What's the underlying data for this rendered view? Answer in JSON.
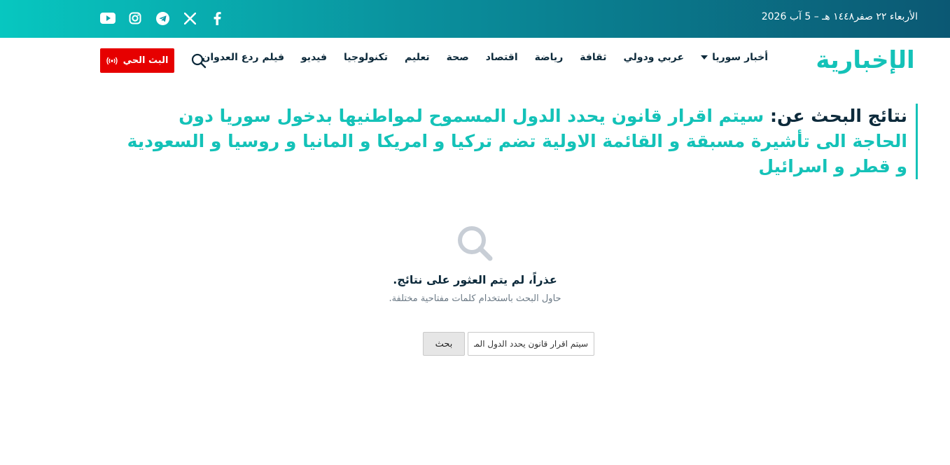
{
  "topbar": {
    "date": "الأربعاء ٢٢ صفر١٤٤٨ هـ – 5 آب 2026",
    "socials": [
      "youtube-icon",
      "instagram-icon",
      "telegram-icon",
      "x-icon",
      "facebook-icon"
    ],
    "gradient": [
      "#07c7c0",
      "#0b5873"
    ]
  },
  "nav": {
    "logo_text": "الإخبارية",
    "items": [
      {
        "label": "أخبار سوريا",
        "has_dropdown": true
      },
      {
        "label": "عربي ودولي"
      },
      {
        "label": "ثقافة"
      },
      {
        "label": "رياضة"
      },
      {
        "label": "اقتصاد"
      },
      {
        "label": "صحة"
      },
      {
        "label": "تعليم"
      },
      {
        "label": "تكنولوجيا"
      },
      {
        "label": "فيديو"
      },
      {
        "label": "فيلم ردع العدوان"
      }
    ],
    "live_label": "البث الحي",
    "live_color": "#e60000"
  },
  "results": {
    "label": "نتائج البحث عن:",
    "query": "سيتم اقرار قانون يحدد الدول المسموح لمواطنيها بدخول سوريا دون الحاجة الى تأشيرة مسبقة و القائمة الاولية تضم تركيا و امريكا و المانيا و روسيا و السعودية و قطر و اسرائيل",
    "accent": "#14c2b8"
  },
  "empty_state": {
    "title": "عذراً، لم يتم العثور على نتائج.",
    "subtitle": "حاول البحث باستخدام كلمات مفتاحية مختلفة.",
    "search_value": "سيتم اقرار قانون يحدد الدول المسموح",
    "search_button": "بحث"
  }
}
